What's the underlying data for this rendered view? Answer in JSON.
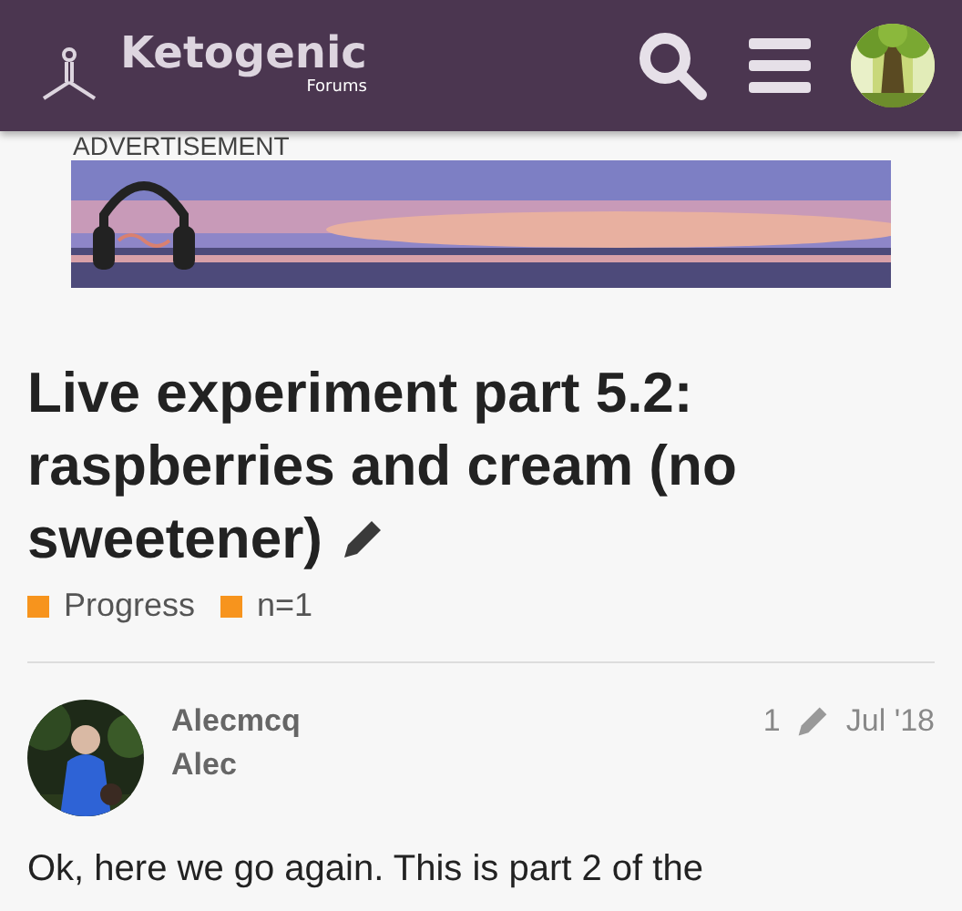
{
  "header": {
    "logo_title": "Ketogenic",
    "logo_subtitle": "Forums"
  },
  "advertisement": {
    "label": "ADVERTISEMENT",
    "kind": "picture"
  },
  "topic": {
    "title": "Live experiment part 5.2: raspberries and cream (no sweetener)",
    "tags": [
      {
        "label": "Progress",
        "color": "#f7941d"
      },
      {
        "label": "n=1",
        "color": "#f7941d"
      }
    ]
  },
  "post": {
    "username": "Alecmcq",
    "name": "Alec",
    "edits": "1",
    "date": "Jul '18",
    "body": "Ok, here we go again. This is part 2 of the"
  }
}
